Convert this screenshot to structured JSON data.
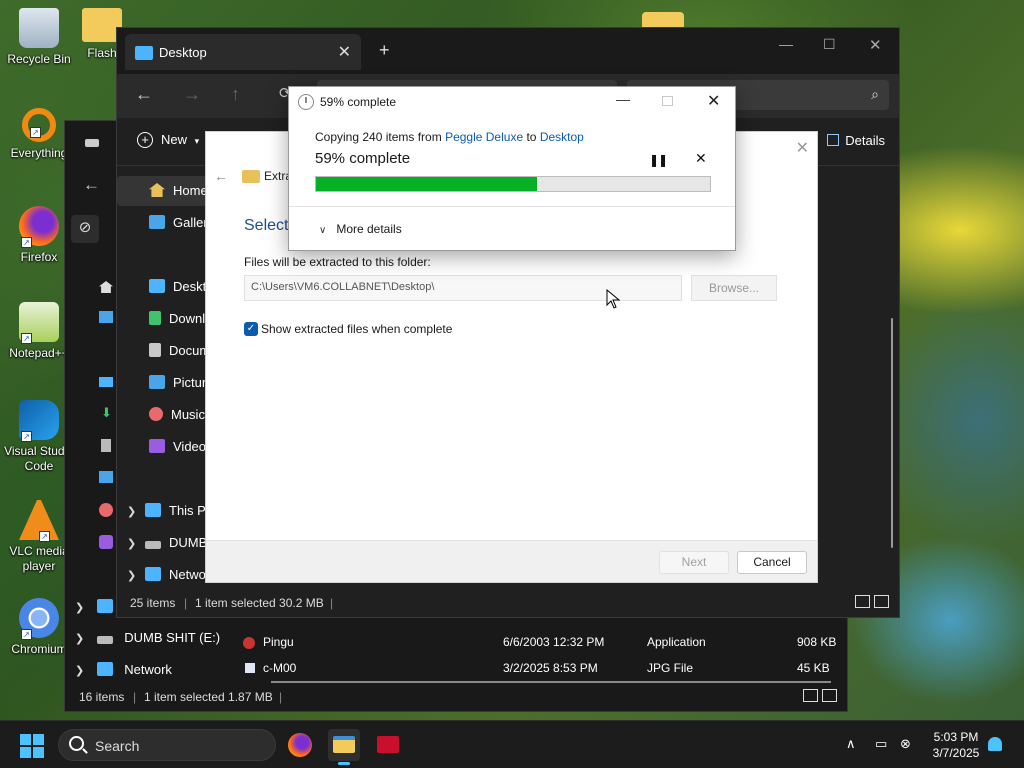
{
  "desktop": {
    "icons": [
      {
        "label": "Recycle Bin",
        "icon": "recycle-bin-icon"
      },
      {
        "label": "Flash",
        "icon": "folder-icon"
      },
      {
        "label": "Everything",
        "icon": "everything-search-icon"
      },
      {
        "label": "Firefox",
        "icon": "firefox-icon"
      },
      {
        "label": "Notepad++",
        "icon": "notepad-plus-plus-icon"
      },
      {
        "label": "Visual Studio Code",
        "icon": "vscode-icon"
      },
      {
        "label": "VLC media player",
        "icon": "vlc-icon"
      },
      {
        "label": "Chromium",
        "icon": "chromium-icon"
      }
    ]
  },
  "explorer_front": {
    "tab_title": "Desktop",
    "new_tab": "+",
    "new_label": "New",
    "details_label": "Details",
    "nav_items": [
      {
        "label": "Home",
        "icon": "home-icon"
      },
      {
        "label": "Gallery",
        "icon": "gallery-icon"
      },
      {
        "label": "Desktop",
        "icon": "desktop-folder-icon"
      },
      {
        "label": "Downloads",
        "icon": "downloads-icon"
      },
      {
        "label": "Documents",
        "icon": "documents-icon"
      },
      {
        "label": "Pictures",
        "icon": "pictures-icon"
      },
      {
        "label": "Music",
        "icon": "music-icon"
      },
      {
        "label": "Videos",
        "icon": "videos-icon"
      },
      {
        "label": "This PC",
        "icon": "this-pc-icon"
      },
      {
        "label": "DUMB",
        "icon": "drive-icon"
      },
      {
        "label": "Network",
        "icon": "network-icon"
      }
    ],
    "status": {
      "count": "25 items",
      "selected": "1 item selected 30.2 MB"
    }
  },
  "explorer_back": {
    "nav_items": [
      {
        "label": "DUMB SHIT (E:)",
        "icon": "drive-icon"
      },
      {
        "label": "Network",
        "icon": "network-icon"
      }
    ],
    "files": [
      {
        "name": "Pingu",
        "date": "6/6/2003 12:32 PM",
        "type": "Application",
        "size": "908 KB"
      },
      {
        "name": "c-M00",
        "date": "3/2/2025 8:53 PM",
        "type": "JPG File",
        "size": "45 KB"
      }
    ],
    "status": {
      "count": "16 items",
      "selected": "1 item selected 1.87 MB"
    }
  },
  "wizard": {
    "title": "Extra",
    "heading": "Select",
    "folder_label": "Files will be extracted to this folder:",
    "path": "C:\\Users\\VM6.COLLABNET\\Desktop\\",
    "browse": "Browse...",
    "checkbox_label": "Show extracted files when complete",
    "checkbox_checked": true,
    "next": "Next",
    "cancel": "Cancel"
  },
  "progress": {
    "title": "59% complete",
    "copying_prefix": "Copying 240 items from ",
    "source": "Peggle Deluxe",
    "to_word": " to ",
    "destination": "Desktop",
    "percent_label": "59% complete",
    "percent_value": 0.56,
    "more_details": "More details",
    "bar_color": "#06b025"
  },
  "taskbar": {
    "search_label": "Search",
    "time": "5:03 PM",
    "date": "3/7/2025",
    "apps": [
      {
        "name": "firefox",
        "icon": "firefox-icon"
      },
      {
        "name": "file-explorer",
        "icon": "file-explorer-icon"
      },
      {
        "name": "terminal",
        "icon": "terminal-icon"
      }
    ]
  }
}
